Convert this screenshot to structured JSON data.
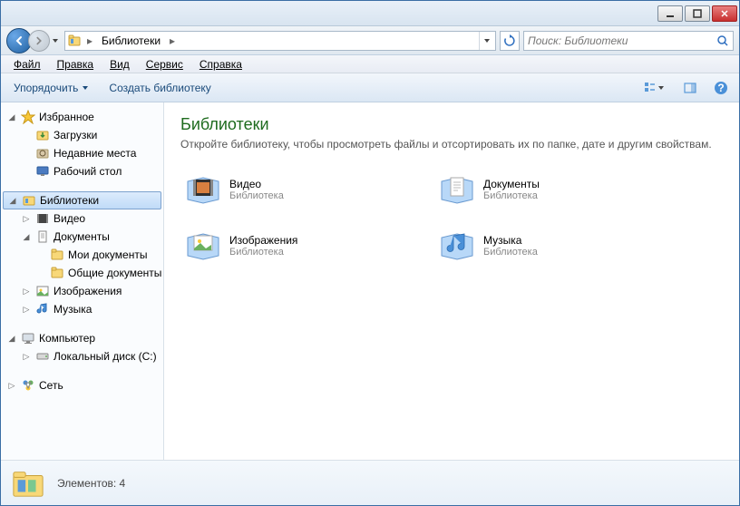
{
  "breadcrumb": {
    "root": "Библиотеки"
  },
  "search": {
    "placeholder": "Поиск: Библиотеки"
  },
  "menu": {
    "file": "Файл",
    "edit": "Правка",
    "view": "Вид",
    "tools": "Сервис",
    "help": "Справка"
  },
  "toolbar": {
    "organize": "Упорядочить",
    "newlib": "Создать библиотеку"
  },
  "sidebar": {
    "favorites": {
      "label": "Избранное",
      "downloads": "Загрузки",
      "recent": "Недавние места",
      "desktop": "Рабочий стол"
    },
    "libraries": {
      "label": "Библиотеки",
      "video": "Видео",
      "documents": "Документы",
      "mydocs": "Мои документы",
      "pubdocs": "Общие документы",
      "images": "Изображения",
      "music": "Музыка"
    },
    "computer": {
      "label": "Компьютер",
      "localc": "Локальный диск (C:)"
    },
    "network": {
      "label": "Сеть"
    }
  },
  "content": {
    "title": "Библиотеки",
    "subtitle": "Откройте библиотеку, чтобы просмотреть файлы и отсортировать их по папке, дате и другим свойствам.",
    "typeLabel": "Библиотека",
    "items": {
      "video": "Видео",
      "documents": "Документы",
      "images": "Изображения",
      "music": "Музыка"
    }
  },
  "status": {
    "text": "Элементов: 4"
  }
}
